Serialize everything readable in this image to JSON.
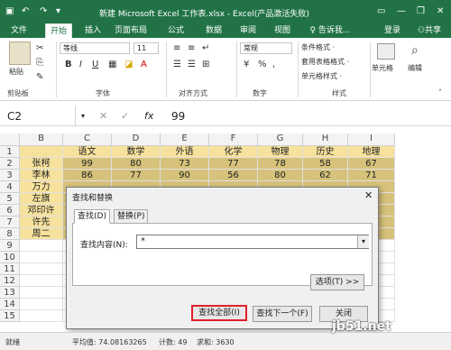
{
  "app": {
    "title": "新建 Microsoft Excel 工作表.xlsx - Excel(产品激活失败)",
    "accent": "#217346"
  },
  "tabs": [
    {
      "label": "文件"
    },
    {
      "label": "开始"
    },
    {
      "label": "插入"
    },
    {
      "label": "页面布局"
    },
    {
      "label": "公式"
    },
    {
      "label": "数据"
    },
    {
      "label": "审阅"
    },
    {
      "label": "视图"
    },
    {
      "label": "♀ 告诉我..."
    }
  ],
  "account": {
    "login": "登录",
    "share": "共享"
  },
  "ribbon": {
    "paste": "粘贴",
    "font_name": "等线",
    "font_size": "11",
    "number_format": "常规",
    "conditional_format": "条件格式 ·",
    "table_format": "套用表格格式 ·",
    "cell_styles": "单元格样式 ·",
    "cells": "单元格",
    "editing": "编辑",
    "groups": {
      "clipboard": "剪贴板",
      "font": "字体",
      "alignment": "对齐方式",
      "number": "数字",
      "styles": "样式"
    }
  },
  "formula_bar": {
    "name_box": "C2",
    "fx": "fx",
    "value": "99"
  },
  "sheet": {
    "columns": [
      "B",
      "C",
      "D",
      "E",
      "F",
      "G",
      "H",
      "I"
    ],
    "header_row": [
      "",
      "语文",
      "数学",
      "外语",
      "化学",
      "物理",
      "历史",
      "地理"
    ],
    "rows": [
      {
        "num": "1",
        "cells": [
          "",
          "语文",
          "数学",
          "外语",
          "化学",
          "物理",
          "历史",
          "地理"
        ]
      },
      {
        "num": "2",
        "cells": [
          "张柯",
          "99",
          "80",
          "73",
          "77",
          "78",
          "58",
          "67"
        ]
      },
      {
        "num": "3",
        "cells": [
          "李林",
          "86",
          "77",
          "90",
          "56",
          "80",
          "62",
          "71"
        ]
      },
      {
        "num": "4",
        "cells": [
          "万力",
          "",
          "",
          "",
          "",
          "",
          "",
          ""
        ]
      },
      {
        "num": "5",
        "cells": [
          "左旗",
          "",
          "",
          "",
          "",
          "",
          "",
          ""
        ]
      },
      {
        "num": "6",
        "cells": [
          "邓印许",
          "",
          "",
          "",
          "",
          "",
          "",
          ""
        ]
      },
      {
        "num": "7",
        "cells": [
          "许先",
          "",
          "",
          "",
          "",
          "",
          "",
          ""
        ]
      },
      {
        "num": "8",
        "cells": [
          "周二",
          "",
          "",
          "",
          "",
          "",
          "",
          ""
        ]
      },
      {
        "num": "9",
        "cells": [
          "",
          "",
          "",
          "",
          "",
          "",
          "",
          ""
        ]
      },
      {
        "num": "10",
        "cells": [
          "",
          "",
          "",
          "",
          "",
          "",
          "",
          ""
        ]
      },
      {
        "num": "11",
        "cells": [
          "",
          "",
          "",
          "",
          "",
          "",
          "",
          ""
        ]
      },
      {
        "num": "12",
        "cells": [
          "",
          "",
          "",
          "",
          "",
          "",
          "",
          ""
        ]
      },
      {
        "num": "13",
        "cells": [
          "",
          "",
          "",
          "",
          "",
          "",
          "",
          ""
        ]
      },
      {
        "num": "14",
        "cells": [
          "",
          "",
          "",
          "",
          "",
          "",
          "",
          ""
        ]
      },
      {
        "num": "15",
        "cells": [
          "",
          "",
          "",
          "",
          "",
          "",
          "",
          ""
        ]
      }
    ]
  },
  "dialog": {
    "title": "查找和替换",
    "tab_find": "查找(D)",
    "tab_replace": "替换(P)",
    "find_label": "查找内容(N):",
    "find_value": "*",
    "options": "选项(T) >>",
    "find_all": "查找全部(I)",
    "find_next": "查找下一个(F)",
    "close": "关闭"
  },
  "status": {
    "ready": "就绪",
    "average": "平均值: 74.08163265",
    "count": "计数: 49",
    "sum": "求和: 3630"
  },
  "watermark": "jb51.net"
}
